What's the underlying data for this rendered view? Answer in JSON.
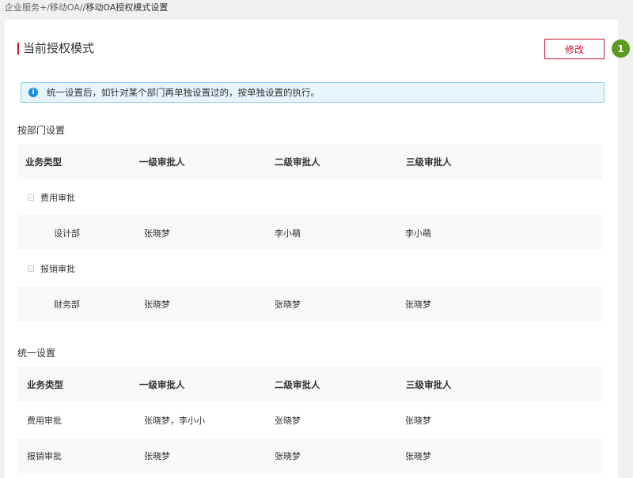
{
  "breadcrumb": {
    "path": "企业服务+/移动OA/",
    "current": "/移动OA授权模式设置"
  },
  "header": {
    "title": "当前授权模式",
    "modify_label": "修改",
    "step_badge": "1"
  },
  "notice": {
    "icon": "info-icon",
    "text": "统一设置后，如针对某个部门再单独设置过的，按单独设置的执行。"
  },
  "by_department": {
    "section_title": "按部门设置",
    "columns": [
      "业务类型",
      "一级审批人",
      "二级审批人",
      "三级审批人"
    ],
    "groups": [
      {
        "name": "费用审批",
        "rows": [
          {
            "dept": "设计部",
            "level1": "张晓梦",
            "level2": "李小萌",
            "level3": "李小萌"
          }
        ]
      },
      {
        "name": "报销审批",
        "rows": [
          {
            "dept": "财务部",
            "level1": "张晓梦",
            "level2": "张晓梦",
            "level3": "张晓梦"
          }
        ]
      }
    ]
  },
  "unified": {
    "section_title": "统一设置",
    "columns": [
      "业务类型",
      "一级审批人",
      "二级审批人",
      "三级审批人"
    ],
    "rows": [
      {
        "type": "费用审批",
        "level1": "张晓梦，李小小",
        "level2": "张晓梦",
        "level3": "张晓梦"
      },
      {
        "type": "报销审批",
        "level1": "张晓梦",
        "level2": "张晓梦",
        "level3": "张晓梦"
      }
    ]
  },
  "colors": {
    "accent": "#c8102e",
    "badge": "#5b9a1d",
    "notice_bg": "#e6f4fb",
    "info_icon": "#1d8fe1"
  }
}
